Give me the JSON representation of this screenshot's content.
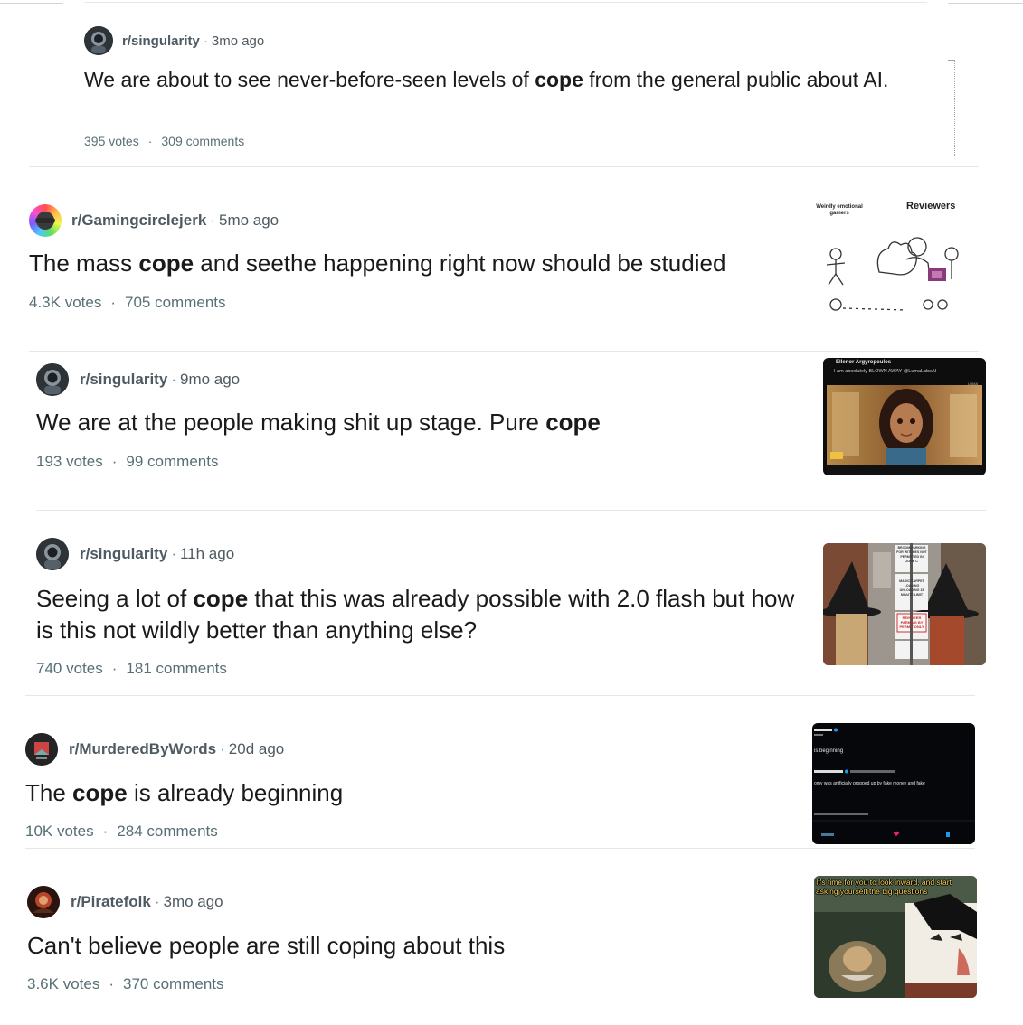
{
  "posts": [
    {
      "subreddit": "r/singularity",
      "age": "3mo ago",
      "title_pre": "We are about to see never-before-seen levels of ",
      "title_em": "cope",
      "title_post": " from the general public about AI.",
      "votes": "395 votes",
      "comments": "309 comments"
    },
    {
      "subreddit": "r/Gamingcirclejerk",
      "age": "5mo ago",
      "title_pre": "The mass ",
      "title_em": "cope",
      "title_post": " and seethe happening right now should be studied",
      "votes": "4.3K votes",
      "comments": "705 comments",
      "thumb_text": {
        "left": "Weirdly emotional gamers",
        "right": "Reviewers"
      }
    },
    {
      "subreddit": "r/singularity",
      "age": "9mo ago",
      "title_pre": "We are at the people making shit up stage. Pure ",
      "title_em": "cope",
      "title_post": "",
      "votes": "193 votes",
      "comments": "99 comments",
      "thumb_text": {
        "name": "Ellenor Argyropoulos",
        "tweet": "I am absolutely BLOWN AWAY @LumaLabsAI",
        "tag": "LUMA"
      }
    },
    {
      "subreddit": "r/singularity",
      "age": "11h ago",
      "title_pre": "Seeing a lot of ",
      "title_em": "cope",
      "title_post": " that this was already possible with 2.0 flash but how is this not wildly better than anything else?",
      "votes": "740 votes",
      "comments": "181 comments",
      "thumb_text": {
        "sign_top": "BROOM PARKING FOR WITCHES NOT PERMITTED IN ZONE C",
        "sign_mid": "MAGIC CARPET LOADING UNLOADING 15 MINUTE LIMIT",
        "sign_red": "REINDEER PARKING BY PERMIT ONLY"
      }
    },
    {
      "subreddit": "r/MurderedByWords",
      "age": "20d ago",
      "title_pre": "The ",
      "title_em": "cope",
      "title_post": " is already beginning",
      "votes": "10K votes",
      "comments": "284 comments",
      "thumb_text": {
        "line1": "is beginning",
        "line2": "omy was artificially propped up by fake money and fake"
      }
    },
    {
      "subreddit": "r/Piratefolk",
      "age": "3mo ago",
      "title_pre": "Can't believe people are still coping about this",
      "title_em": "",
      "title_post": "",
      "votes": "3.6K votes",
      "comments": "370 comments",
      "thumb_text": {
        "caption": "It's time for you to look inward, and start asking yourself the big questions"
      }
    }
  ],
  "separator": "·",
  "colors": {
    "meta": "#4e5a62",
    "stats": "#576f76",
    "divider": "#e5e7e9",
    "title": "#1a1a1b"
  }
}
